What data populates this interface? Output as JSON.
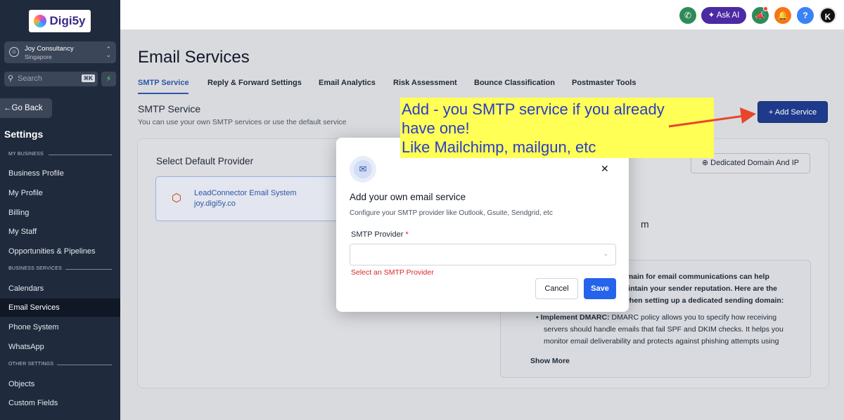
{
  "sidebar": {
    "logo_text": "Digi5y",
    "account_name": "Joy Consultancy",
    "account_location": "Singapore",
    "search_placeholder": "Search",
    "search_shortcut": "⌘K",
    "go_back": "Go Back",
    "settings_title": "Settings",
    "sections": {
      "my_business": "MY BUSINESS",
      "business_services": "BUSINESS SERVICES",
      "other_settings": "OTHER SETTINGS"
    },
    "items": [
      "Business Profile",
      "My Profile",
      "Billing",
      "My Staff",
      "Opportunities & Pipelines",
      "Calendars",
      "Email Services",
      "Phone System",
      "WhatsApp",
      "Objects",
      "Custom Fields"
    ],
    "active_item": "Email Services"
  },
  "topbar": {
    "ask_ai": "Ask AI",
    "help": "?",
    "avatar_initials": "K"
  },
  "page": {
    "title": "Email Services",
    "tabs": [
      "SMTP Service",
      "Reply & Forward Settings",
      "Email Analytics",
      "Risk Assessment",
      "Bounce Classification",
      "Postmaster Tools"
    ],
    "active_tab": "SMTP Service",
    "section_title": "SMTP Service",
    "section_desc": "You can use your own SMTP services or use the default service",
    "add_service": "Add Service",
    "default_provider_title": "Select Default Provider",
    "provider_name": "LeadConnector Email System",
    "provider_domain": "joy.digi5y.co",
    "dedicated_button": "Dedicated Domain And IP",
    "partial_heading_tail": "m",
    "info_lines": [
      "domain for email communications can help",
      "maintain your sender reputation. Here are the",
      "e when setting up a dedicated sending domain:",
      "Implement DMARC: DMARC policy allows you to specify how receiving",
      "servers should handle emails that fail SPF and DKIM checks. It helps you",
      "monitor email deliverability and protects against phishing attempts using"
    ],
    "show_more": "Show More"
  },
  "modal": {
    "title": "Add your own email service",
    "description": "Configure your SMTP provider like Outlook, Gsuite, Sendgrid, etc",
    "field_label": "SMTP Provider",
    "required_mark": "*",
    "select_value": "",
    "error": "Select an SMTP Provider",
    "cancel": "Cancel",
    "save": "Save"
  },
  "annotation": {
    "lines": [
      "Add - you SMTP service if you already",
      "have one!",
      "Like Mailchimp, mailgun, etc"
    ]
  },
  "colors": {
    "sidebar_bg": "#1f2a3c",
    "accent": "#2d56a8",
    "primary_button": "#1e3a8a",
    "save_button": "#2563eb",
    "error": "#dc2626",
    "annotation_bg": "#ffff55",
    "annotation_text": "#2a3cc8",
    "arrow": "#e8452c"
  }
}
